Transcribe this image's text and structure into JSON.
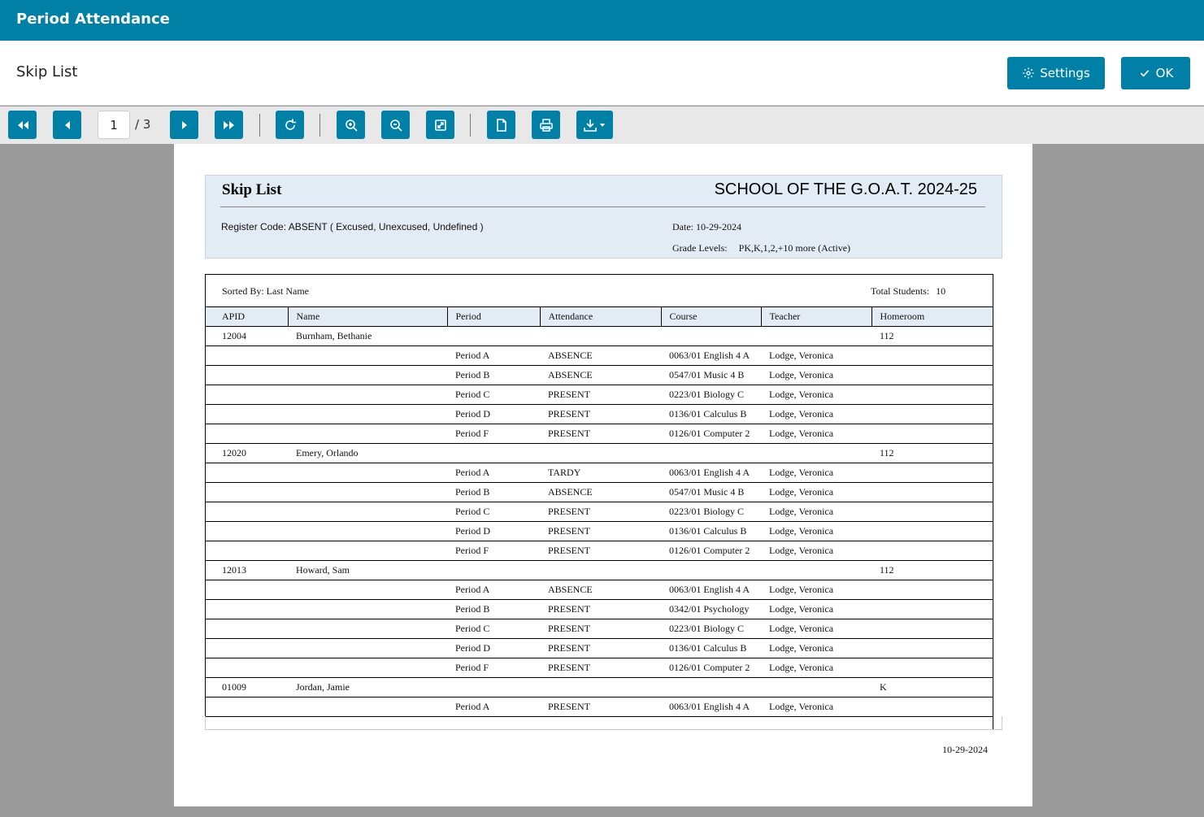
{
  "window": {
    "title": "Period Attendance"
  },
  "header": {
    "subtitle": "Skip List",
    "settings_label": "Settings",
    "ok_label": "OK"
  },
  "toolbar": {
    "current_page": "1",
    "total_pages": "/ 3",
    "icons": [
      "first-page-icon",
      "prev-page-icon",
      "next-page-icon",
      "last-page-icon",
      "refresh-icon",
      "zoom-in-icon",
      "zoom-out-icon",
      "fit-page-icon",
      "document-icon",
      "print-icon",
      "download-icon"
    ]
  },
  "report": {
    "title": "Skip List",
    "school": "SCHOOL OF THE G.O.A.T. 2024-25",
    "register_code": "Register Code: ABSENT ( Excused, Unexcused, Undefined )",
    "date": "Date: 10-29-2024",
    "grade_levels_label": "Grade Levels:",
    "grade_levels_value": "PK,K,1,2,+10 more (Active)",
    "sorted_by": "Sorted By: Last Name",
    "total_students_label": "Total Students:",
    "total_students_value": "10",
    "columns": [
      "APID",
      "Name",
      "Period",
      "Attendance",
      "Course",
      "Teacher",
      "Homeroom"
    ],
    "rows": [
      [
        "12004",
        "Burnham, Bethanie",
        "",
        "",
        "",
        "",
        "112"
      ],
      [
        "",
        "",
        "Period A",
        "ABSENCE",
        "0063/01 English 4 A",
        "Lodge, Veronica",
        ""
      ],
      [
        "",
        "",
        "Period B",
        "ABSENCE",
        "0547/01 Music 4 B",
        "Lodge, Veronica",
        ""
      ],
      [
        "",
        "",
        "Period C",
        "PRESENT",
        "0223/01 Biology C",
        "Lodge, Veronica",
        ""
      ],
      [
        "",
        "",
        "Period D",
        "PRESENT",
        "0136/01 Calculus B",
        "Lodge, Veronica",
        ""
      ],
      [
        "",
        "",
        "Period F",
        "PRESENT",
        "0126/01 Computer 2",
        "Lodge, Veronica",
        ""
      ],
      [
        "12020",
        "Emery, Orlando",
        "",
        "",
        "",
        "",
        "112"
      ],
      [
        "",
        "",
        "Period A",
        "TARDY",
        "0063/01 English 4 A",
        "Lodge, Veronica",
        ""
      ],
      [
        "",
        "",
        "Period B",
        "ABSENCE",
        "0547/01 Music 4 B",
        "Lodge, Veronica",
        ""
      ],
      [
        "",
        "",
        "Period C",
        "PRESENT",
        "0223/01 Biology C",
        "Lodge, Veronica",
        ""
      ],
      [
        "",
        "",
        "Period D",
        "PRESENT",
        "0136/01 Calculus B",
        "Lodge, Veronica",
        ""
      ],
      [
        "",
        "",
        "Period F",
        "PRESENT",
        "0126/01 Computer 2",
        "Lodge, Veronica",
        ""
      ],
      [
        "12013",
        "Howard, Sam",
        "",
        "",
        "",
        "",
        "112"
      ],
      [
        "",
        "",
        "Period A",
        "ABSENCE",
        "0063/01 English 4 A",
        "Lodge, Veronica",
        ""
      ],
      [
        "",
        "",
        "Period B",
        "PRESENT",
        "0342/01 Psychology",
        "Lodge, Veronica",
        ""
      ],
      [
        "",
        "",
        "Period C",
        "PRESENT",
        "0223/01 Biology C",
        "Lodge, Veronica",
        ""
      ],
      [
        "",
        "",
        "Period D",
        "PRESENT",
        "0136/01 Calculus B",
        "Lodge, Veronica",
        ""
      ],
      [
        "",
        "",
        "Period F",
        "PRESENT",
        "0126/01 Computer 2",
        "Lodge, Veronica",
        ""
      ],
      [
        "01009",
        "Jordan, Jamie",
        "",
        "",
        "",
        "",
        "K"
      ],
      [
        "",
        "",
        "Period A",
        "PRESENT",
        "0063/01 English 4 A",
        "Lodge, Veronica",
        ""
      ]
    ],
    "footer_date": "10-29-2024"
  },
  "colors": {
    "accent": "#0080a6",
    "viewer_bg": "#9b9b9b",
    "header_band": "#e3ecf5"
  }
}
